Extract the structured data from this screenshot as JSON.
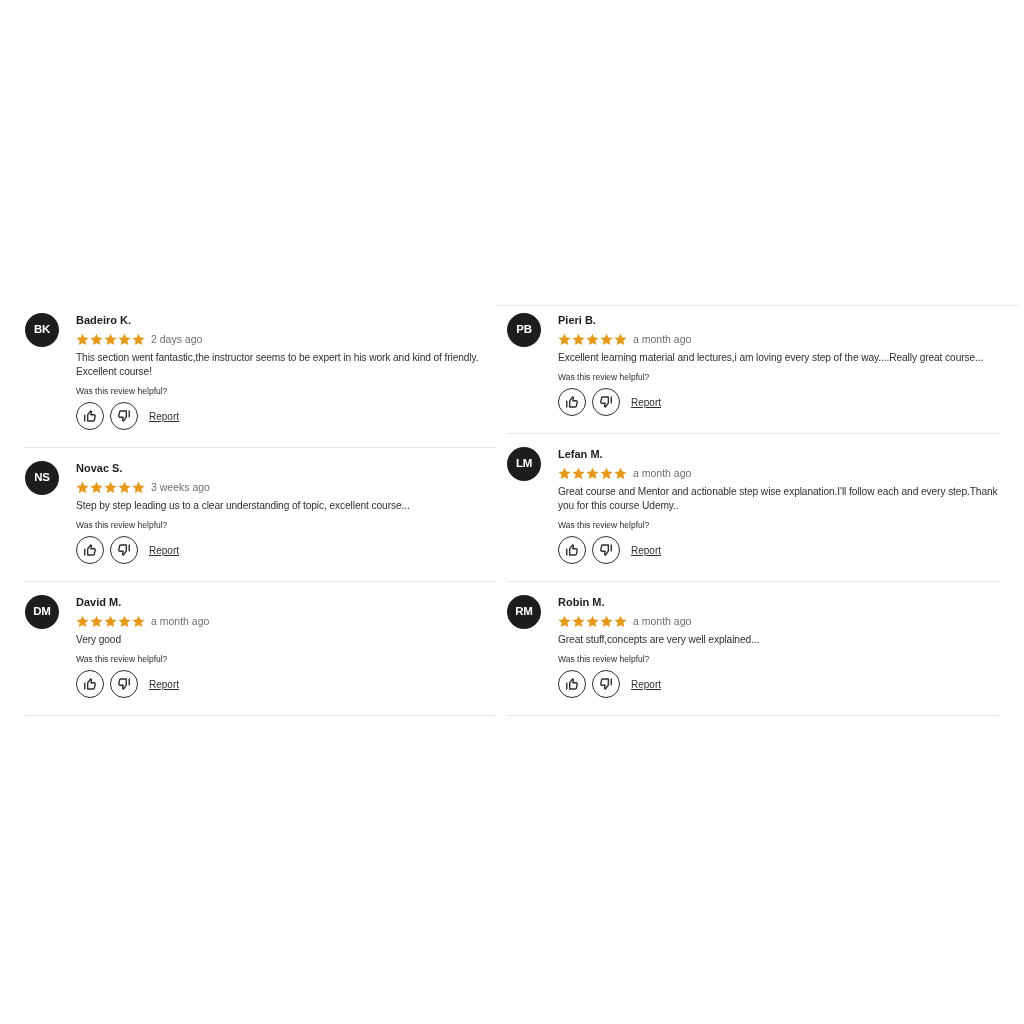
{
  "columns": [
    {
      "reviews": [
        {
          "initials": "BK",
          "name": "Badeiro K.",
          "stars": 5,
          "date": "2 days ago",
          "comment": "This section went fantastic,the instructor seems to be expert in his work and kind of friendly. Excellent course!",
          "helpful_prompt": "Was this review helpful?",
          "report": "Report"
        },
        {
          "initials": "NS",
          "name": "Novac S.",
          "stars": 5,
          "date": "3 weeks ago",
          "comment": "Step by step leading us to a clear understanding of topic, excellent course...",
          "helpful_prompt": "Was this review helpful?",
          "report": "Report"
        },
        {
          "initials": "DM",
          "name": "David M.",
          "stars": 5,
          "date": "a month ago",
          "comment": "Very good",
          "helpful_prompt": "Was this review helpful?",
          "report": "Report"
        }
      ]
    },
    {
      "reviews": [
        {
          "initials": "PB",
          "name": "Pieri B.",
          "stars": 5,
          "date": "a month ago",
          "comment": "Excellent learning material and lectures,i am loving every step of the way....Really great course...",
          "helpful_prompt": "Was this review helpful?",
          "report": "Report"
        },
        {
          "initials": "LM",
          "name": "Lefan M.",
          "stars": 5,
          "date": "a month ago",
          "comment": "Great course and Mentor and actionable step wise explanation.I'll follow each and every step.Thank you for this course Udemy..",
          "helpful_prompt": "Was this review helpful?",
          "report": "Report"
        },
        {
          "initials": "RM",
          "name": "Robin M.",
          "stars": 5,
          "date": "a month ago",
          "comment": "Great stuff,concepts are very well explained...",
          "helpful_prompt": "Was this review helpful?",
          "report": "Report"
        }
      ]
    }
  ]
}
